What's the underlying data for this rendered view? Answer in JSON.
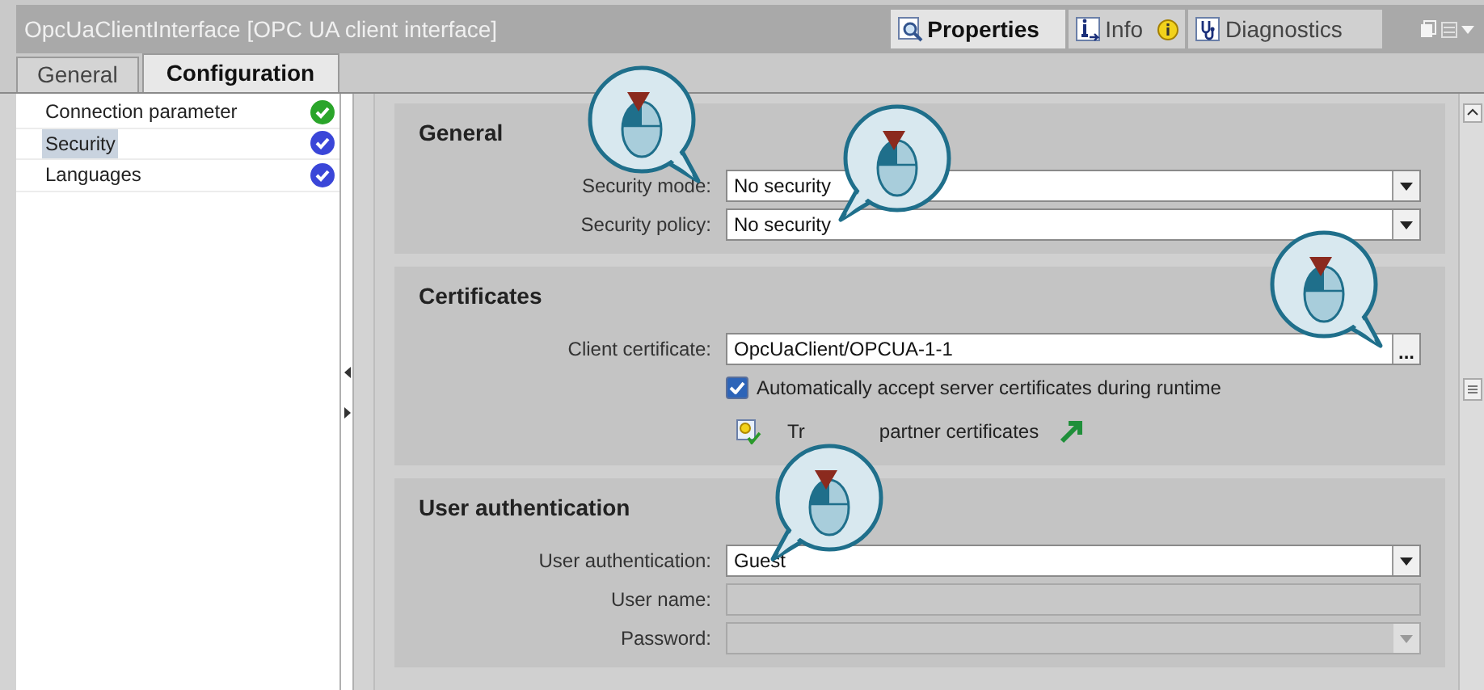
{
  "window": {
    "title": "OpcUaClientInterface [OPC UA client interface]"
  },
  "inspector_tabs": [
    {
      "label": "Properties",
      "kind": "properties",
      "selected": true
    },
    {
      "label": "Info",
      "kind": "info",
      "selected": false
    },
    {
      "label": "Diagnostics",
      "kind": "diagnostics",
      "selected": false
    }
  ],
  "tabs": [
    {
      "label": "General",
      "selected": false
    },
    {
      "label": "Configuration",
      "selected": true
    }
  ],
  "nav": [
    {
      "label": "Connection parameter",
      "selected": false,
      "color": "#2aa52a"
    },
    {
      "label": "Security",
      "selected": true,
      "color": "#3a46d8"
    },
    {
      "label": "Languages",
      "selected": false,
      "color": "#3a46d8"
    }
  ],
  "sections": [
    {
      "title": "General",
      "fields": [
        {
          "kind": "dropdown",
          "label": "Security mode:",
          "value": "No security",
          "disabled": false
        },
        {
          "kind": "dropdown",
          "label": "Security policy:",
          "value": "No security",
          "disabled": false
        }
      ]
    },
    {
      "title": "Certificates",
      "fields": [
        {
          "kind": "browse",
          "label": "Client certificate:",
          "value": "OpcUaClient/OPCUA-1-1",
          "button_label": "..."
        },
        {
          "kind": "checkbox",
          "label": "Automatically accept server certificates during runtime",
          "checked": true
        },
        {
          "kind": "link",
          "parts": [
            "Tr",
            "partner certificates"
          ]
        }
      ]
    },
    {
      "title": "User authentication",
      "fields": [
        {
          "kind": "dropdown",
          "label": "User authentication:",
          "value": "Guest",
          "disabled": false
        },
        {
          "kind": "text",
          "label": "User name:",
          "disabled": true
        },
        {
          "kind": "dropdown",
          "label": "Password:",
          "disabled": true
        }
      ]
    }
  ]
}
